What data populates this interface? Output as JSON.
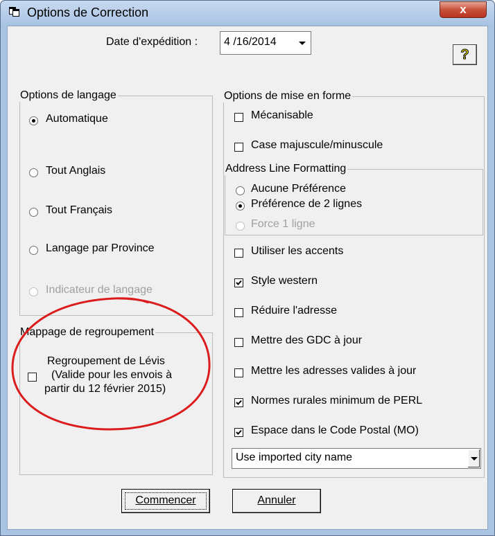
{
  "window": {
    "title": "Options de Correction",
    "close_glyph": "x",
    "icon": "window-icon"
  },
  "header": {
    "date_label": "Date d'expédition :",
    "date_value": "4 /16/2014",
    "help_glyph": "?"
  },
  "language_options": {
    "title": "Options de langage",
    "items": [
      {
        "label": "Automatique",
        "selected": true,
        "enabled": true
      },
      {
        "label": "Tout Anglais",
        "selected": false,
        "enabled": true
      },
      {
        "label": "Tout Français",
        "selected": false,
        "enabled": true
      },
      {
        "label": "Langage par Province",
        "selected": false,
        "enabled": true
      },
      {
        "label": "Indicateur de langage",
        "selected": false,
        "enabled": false
      }
    ]
  },
  "grouping": {
    "title": "Mappage de regroupement",
    "checkbox_checked": false,
    "line1": "Regroupement de Lévis",
    "line2": "(Valide pour les envois à",
    "line3": "partir du 12 février 2015)"
  },
  "format_options": {
    "title": "Options de mise en forme",
    "items": [
      {
        "label": "Mécanisable",
        "checked": false
      },
      {
        "label": "Case majuscule/minuscule",
        "checked": false
      }
    ]
  },
  "address_line": {
    "title": "Address Line Formatting",
    "items": [
      {
        "label": "Aucune Préférence",
        "selected": false,
        "enabled": true
      },
      {
        "label": "Préférence de 2 lignes",
        "selected": true,
        "enabled": true
      },
      {
        "label": "Force 1 ligne",
        "selected": false,
        "enabled": false
      }
    ]
  },
  "other_options": [
    {
      "label": "Utiliser les accents",
      "checked": false
    },
    {
      "label": "Style western",
      "checked": true
    },
    {
      "label": "Réduire l'adresse",
      "checked": false
    },
    {
      "label": "Mettre des GDC à jour",
      "checked": false
    },
    {
      "label": "Mettre les adresses valides à jour",
      "checked": false
    },
    {
      "label": "Normes rurales minimum de PERL",
      "checked": true
    },
    {
      "label": "Espace dans le Code Postal (MO)",
      "checked": true
    }
  ],
  "city_select": {
    "value": "Use imported city name"
  },
  "buttons": {
    "start": "Commencer",
    "cancel": "Annuler"
  },
  "colors": {
    "frame": "#a9c3e3",
    "dialog_bg": "#f0f0f0",
    "close_red": "#c8503a",
    "disabled_text": "#a0a0a0"
  }
}
